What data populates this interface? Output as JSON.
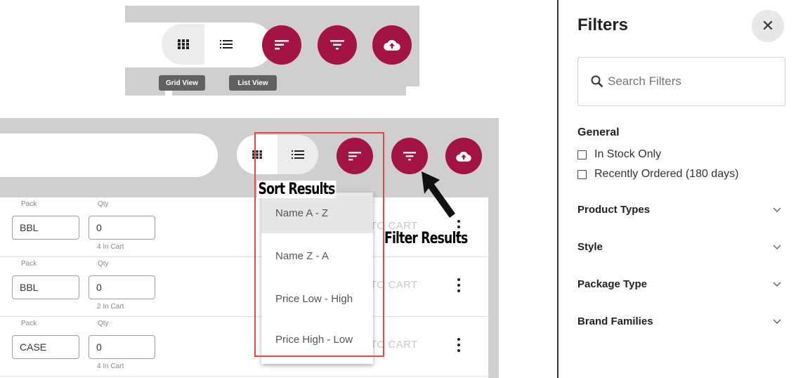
{
  "top_toolbar": {
    "tooltips": {
      "grid_view": "Grid View",
      "list_view": "List View"
    },
    "icons": [
      "grid-icon",
      "list-icon",
      "sort-icon",
      "filter-icon",
      "cloud-upload-icon"
    ]
  },
  "product_rows": [
    {
      "pack_label": "Pack",
      "pack_value": "BBL",
      "qty_label": "Qty",
      "qty_value": "0",
      "in_cart": "4 In Cart",
      "add_label": "TO CART"
    },
    {
      "pack_label": "Pack",
      "pack_value": "BBL",
      "qty_label": "Qty",
      "qty_value": "0",
      "in_cart": "2 In Cart",
      "add_label": "TO CART"
    },
    {
      "pack_label": "Pack",
      "pack_value": "CASE",
      "qty_label": "Qty",
      "qty_value": "0",
      "in_cart": "4 In Cart",
      "add_label": "TO CART"
    }
  ],
  "sort_menu": {
    "items": [
      "Name A - Z",
      "Name Z - A",
      "Price Low - High",
      "Price High - Low"
    ],
    "active_index": 0
  },
  "annotations": {
    "sort": "Sort Results",
    "filter": "Filter Results"
  },
  "filters": {
    "title": "Filters",
    "search_placeholder": "Search Filters",
    "general_heading": "General",
    "checkboxes": [
      "In Stock Only",
      "Recently Ordered (180 days)"
    ],
    "sections": [
      "Product Types",
      "Style",
      "Package Type",
      "Brand Families"
    ]
  },
  "colors": {
    "accent": "#a31445",
    "annotation_box": "#e04a3f",
    "toolbar_bg": "#cfcfcf"
  }
}
